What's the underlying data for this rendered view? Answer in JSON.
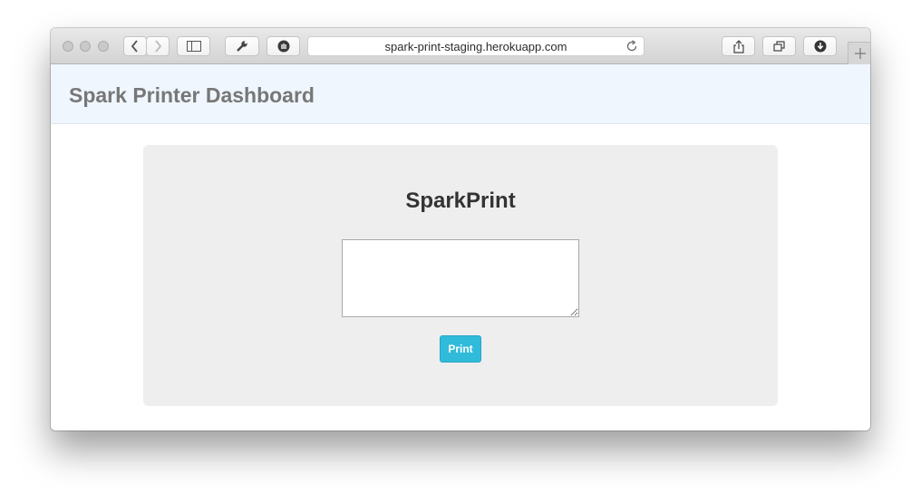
{
  "browser": {
    "url": "spark-print-staging.herokuapp.com",
    "icons": {
      "back": "chevron-left-icon",
      "forward": "chevron-right-icon",
      "sidebar": "sidebar-icon",
      "tools": "wrench-icon",
      "extension": "hand-icon",
      "reload": "reload-icon",
      "share": "share-icon",
      "tabs": "tabs-icon",
      "downloads": "download-icon",
      "new_tab": "plus-icon"
    }
  },
  "navbar": {
    "brand": "Spark Printer Dashboard",
    "background": "#eff6fd"
  },
  "main": {
    "title": "SparkPrint",
    "textarea_value": "",
    "print_label": "Print",
    "accent": "#31bbdb"
  }
}
